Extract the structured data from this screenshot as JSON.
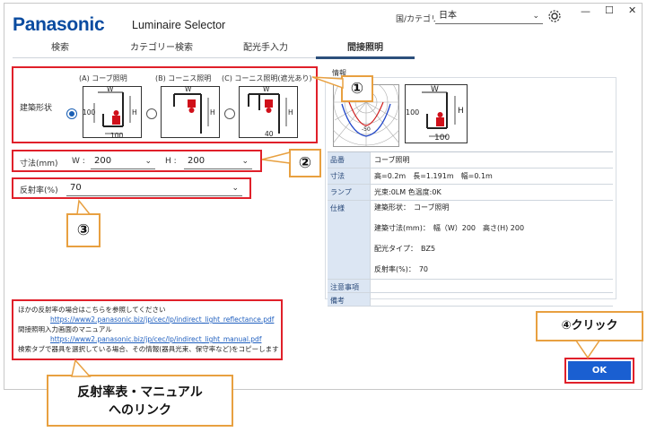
{
  "header": {
    "brand": "Panasonic",
    "app_title": "Luminaire Selector",
    "country_label": "国/カテゴリ",
    "country_value": "日本",
    "window_controls": {
      "minimize": "—",
      "maximize": "☐",
      "close": "✕"
    }
  },
  "tabs": [
    {
      "label": "検索"
    },
    {
      "label": "カテゴリー検索"
    },
    {
      "label": "配光手入力"
    },
    {
      "label": "間接照明",
      "active": true
    }
  ],
  "shape": {
    "label": "建築形状",
    "options": [
      {
        "label": "(A) コーブ照明",
        "selected": true,
        "dims": {
          "w": "W",
          "h": "H",
          "left": "100",
          "bottom": "100"
        }
      },
      {
        "label": "(B) コーニス照明",
        "selected": false,
        "dims": {
          "w": "W",
          "h": "H"
        }
      },
      {
        "label": "(C) コーニス照明(遮光あり)",
        "selected": false,
        "dims": {
          "w": "W",
          "h": "H",
          "bottom": "40"
        }
      }
    ]
  },
  "size": {
    "label": "寸法(mm)",
    "w_label": "W :",
    "w_value": "200",
    "h_label": "H :",
    "h_value": "200"
  },
  "reflect": {
    "label": "反射率(%)",
    "value": "70"
  },
  "info": {
    "title": "情報",
    "polar_label": "-50",
    "diag": {
      "w": "W",
      "h": "H",
      "left": "100",
      "bottom": "100"
    },
    "rows": [
      {
        "label": "品番",
        "value": [
          "コーブ照明"
        ]
      },
      {
        "label": "寸法",
        "value": [
          "高=0.2m　長=1.191m　幅=0.1m"
        ]
      },
      {
        "label": "ランプ",
        "value": [
          "光束:0LM 色温度:0K"
        ]
      },
      {
        "label": "仕様",
        "value": [
          "建築形状：　コーブ照明",
          "建築寸法(mm)：　幅（W）200　高さ(H) 200",
          "配光タイプ：　BZ5",
          "反射率(%)：　70"
        ]
      },
      {
        "label": "注意事項",
        "value": [
          ""
        ]
      },
      {
        "label": "備考",
        "value": [
          ""
        ]
      }
    ]
  },
  "links": {
    "line1": "ほかの反射率の場合はこちらを参照してください",
    "url1": "https://www2.panasonic.biz/jp/cec/lp/indirect_light_reflectance.pdf",
    "line2": "間接照明入力画面のマニュアル",
    "url2": "https://www2.panasonic.biz/jp/cec/lp/indirect_light_manual.pdf",
    "line3": "検索タブで器具を選択している場合、その情報(器具光束、保守率など)をコピーします"
  },
  "ok_label": "OK",
  "callouts": {
    "c1": "①",
    "c2": "②",
    "c3": "③",
    "c4": "④クリック",
    "links_note_1": "反射率表・マニュアル",
    "links_note_2": "へのリンク"
  },
  "colors": {
    "accent": "#1a5fd1",
    "highlight": "#e0202a",
    "callout_border": "#e8a040",
    "brand": "#0a4ba0"
  }
}
